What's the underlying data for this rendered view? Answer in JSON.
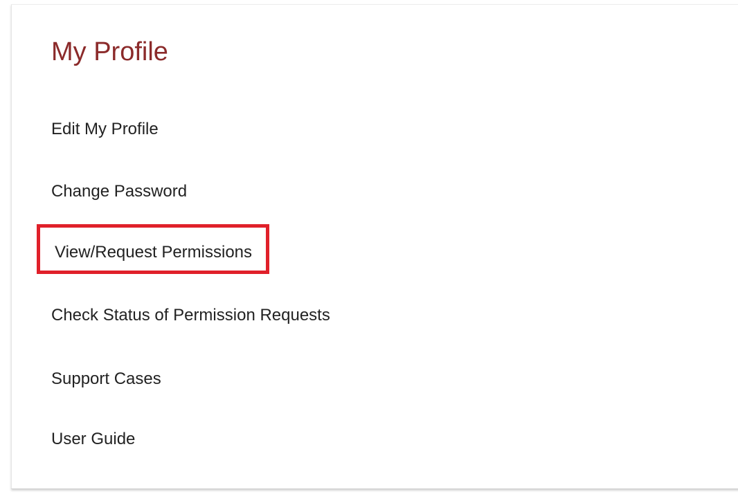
{
  "profile": {
    "title": "My Profile",
    "menu_items": [
      {
        "label": "Edit My Profile"
      },
      {
        "label": "Change Password"
      },
      {
        "label": "View/Request Permissions"
      },
      {
        "label": "Check Status of Permission Requests"
      },
      {
        "label": "Support Cases"
      },
      {
        "label": "User Guide"
      }
    ]
  },
  "colors": {
    "title": "#8b2a2a",
    "highlight_border": "#e0202a",
    "text": "#222222"
  }
}
